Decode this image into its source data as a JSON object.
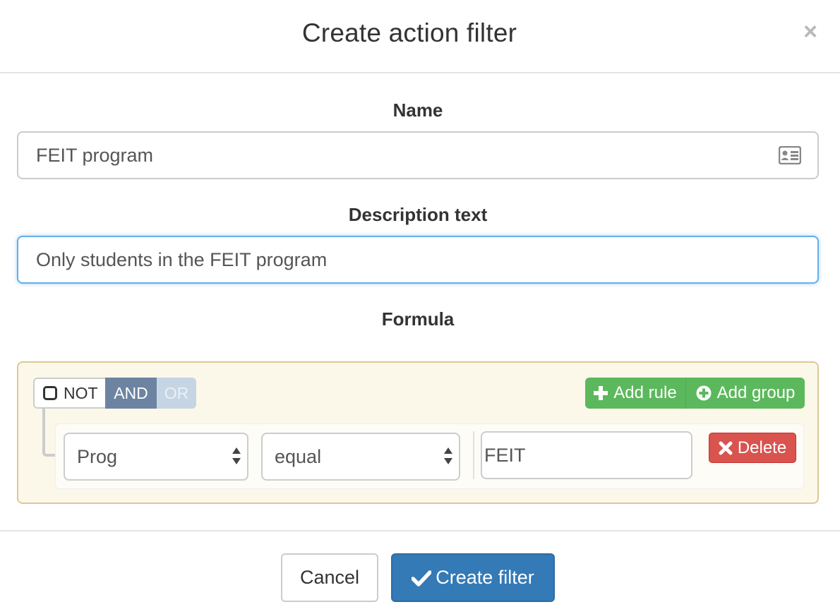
{
  "dialog": {
    "title": "Create action filter",
    "close_glyph": "×"
  },
  "form": {
    "name_label": "Name",
    "name_value": "FEIT program",
    "description_label": "Description text",
    "description_value": "Only students in the FEIT program",
    "formula_label": "Formula"
  },
  "query_builder": {
    "not_label": "NOT",
    "and_label": "AND",
    "or_label": "OR",
    "active_condition": "AND",
    "add_rule_label": "Add rule",
    "add_group_label": "Add group",
    "rules": [
      {
        "field": "Prog",
        "operator": "equal",
        "value": "FEIT",
        "delete_label": "Delete"
      }
    ]
  },
  "footer": {
    "cancel_label": "Cancel",
    "create_label": "Create filter"
  },
  "icons": {
    "close": "close-icon",
    "name_field": "id-card-icon",
    "not_checkbox": "checkbox-empty-icon",
    "add_rule": "plus-icon",
    "add_group": "plus-circle-icon",
    "select_arrows": "sort-arrows-icon",
    "delete": "remove-icon",
    "create": "checkmark-icon"
  },
  "colors": {
    "primary": "#337ab7",
    "success": "#5cb85c",
    "danger": "#d9534f",
    "condition_active": "#6c84a1",
    "condition_inactive": "#c6d5e3",
    "group_background": "#fcf8e9",
    "group_border": "#dcc896",
    "focus_border": "#66afe9"
  }
}
